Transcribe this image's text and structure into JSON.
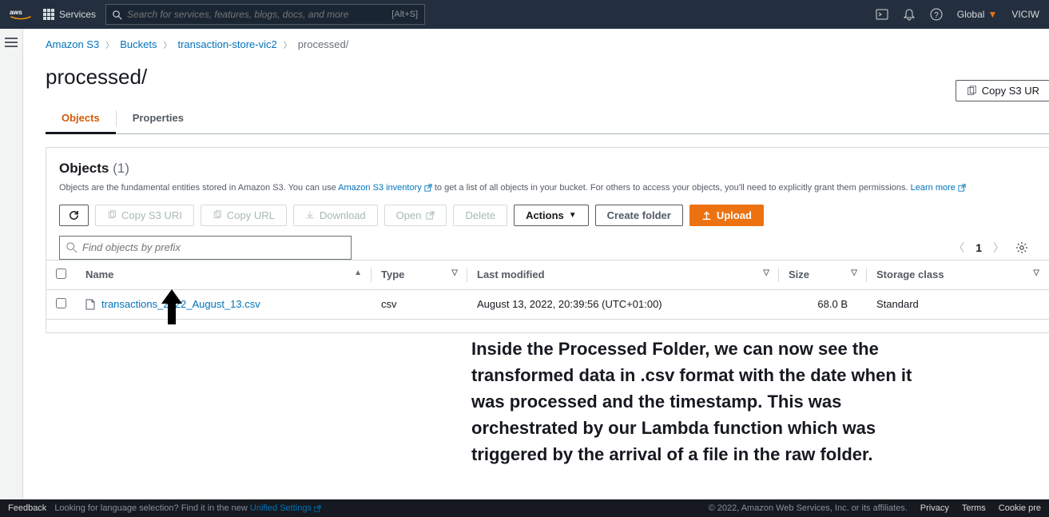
{
  "topnav": {
    "services": "Services",
    "search_placeholder": "Search for services, features, blogs, docs, and more",
    "shortcut": "[Alt+S]",
    "region": "Global",
    "user": "VICIW"
  },
  "breadcrumb": {
    "root": "Amazon S3",
    "buckets": "Buckets",
    "bucket_name": "transaction-store-vic2",
    "current": "processed/"
  },
  "page_title": "processed/",
  "copy_uri_top": "Copy S3 UR",
  "tabs": {
    "objects": "Objects",
    "properties": "Properties"
  },
  "panel": {
    "title": "Objects",
    "count": "(1)",
    "desc1": "Objects are the fundamental entities stored in Amazon S3. You can use ",
    "link1": "Amazon S3 inventory",
    "desc2": " to get a list of all objects in your bucket. For others to access your objects, you'll need to explicitly grant them permissions. ",
    "link2": "Learn more"
  },
  "toolbar": {
    "copy_uri": "Copy S3 URI",
    "copy_url": "Copy URL",
    "download": "Download",
    "open": "Open",
    "delete": "Delete",
    "actions": "Actions",
    "create_folder": "Create folder",
    "upload": "Upload"
  },
  "filter_placeholder": "Find objects by prefix",
  "pager": {
    "page": "1"
  },
  "columns": {
    "name": "Name",
    "type": "Type",
    "last_modified": "Last modified",
    "size": "Size",
    "storage_class": "Storage class"
  },
  "rows": [
    {
      "name": "transactions_2022_August_13.csv",
      "type": "csv",
      "last_modified": "August 13, 2022, 20:39:56 (UTC+01:00)",
      "size": "68.0 B",
      "storage_class": "Standard"
    }
  ],
  "footer": {
    "feedback": "Feedback",
    "lang_prompt": "Looking for language selection? Find it in the new ",
    "lang_link": "Unified Settings",
    "copyright": "© 2022, Amazon Web Services, Inc. or its affiliates.",
    "privacy": "Privacy",
    "terms": "Terms",
    "cookies": "Cookie pre"
  },
  "annotation": "Inside the Processed Folder, we can now see the transformed data in .csv format with the date when it was processed and the timestamp. This was orchestrated by our Lambda function which was triggered by the arrival of a file in the raw folder."
}
